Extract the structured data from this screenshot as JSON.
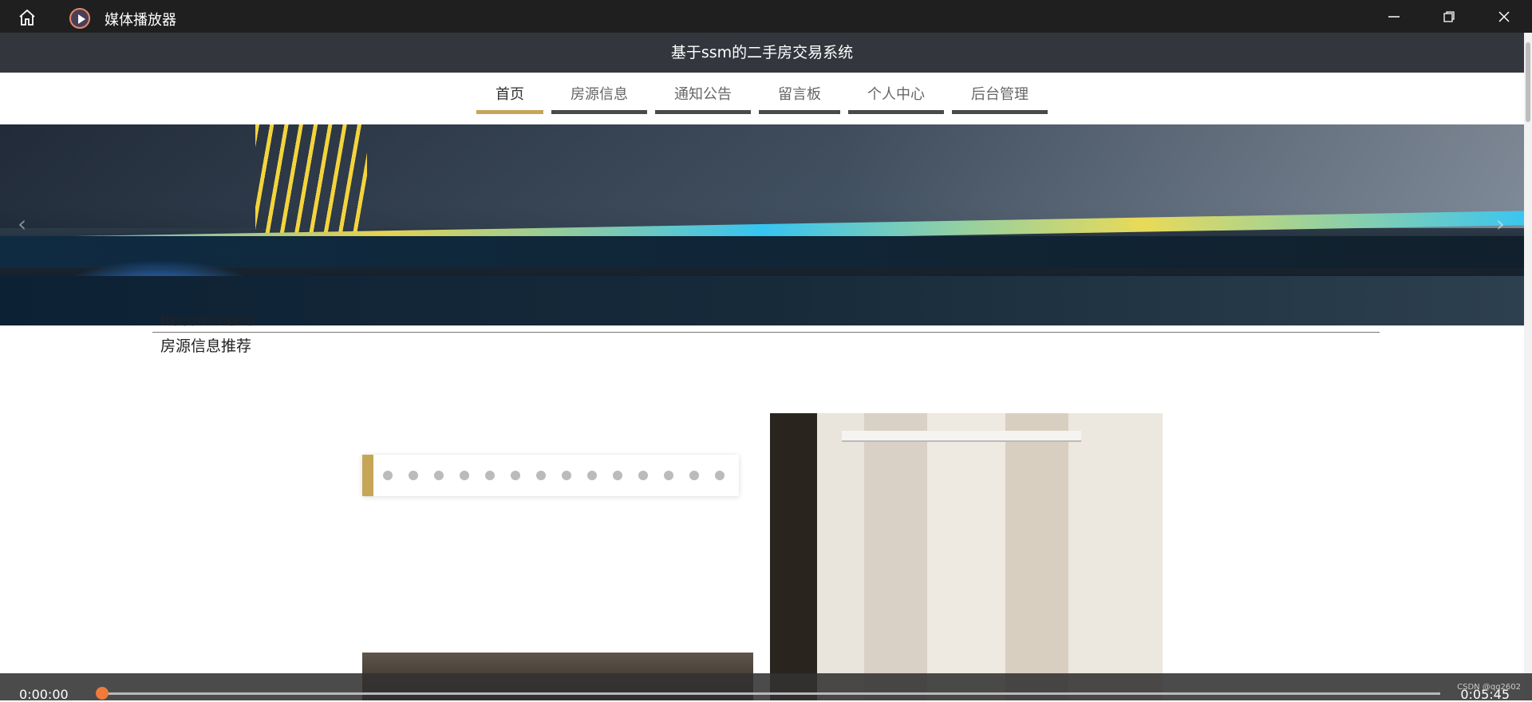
{
  "window": {
    "title": "媒体播放器"
  },
  "site": {
    "title": "基于ssm的二手房交易系统",
    "nav": [
      {
        "label": "首页",
        "active": true
      },
      {
        "label": "房源信息",
        "active": false
      },
      {
        "label": "通知公告",
        "active": false
      },
      {
        "label": "留言板",
        "active": false
      },
      {
        "label": "个人中心",
        "active": false
      },
      {
        "label": "后台管理",
        "active": false
      }
    ],
    "banner": {
      "prev": "‹",
      "next": "›"
    },
    "recommend": {
      "en": "Recommend",
      "cn": "房源信息推荐"
    }
  },
  "player": {
    "current_time": "0:00:00",
    "total_time": "0:05:45",
    "progress": 0
  },
  "watermark": "CSDN @qq2602",
  "colors": {
    "accent": "#c5a657",
    "header": "#33373d",
    "seek": "#f07a3a"
  }
}
